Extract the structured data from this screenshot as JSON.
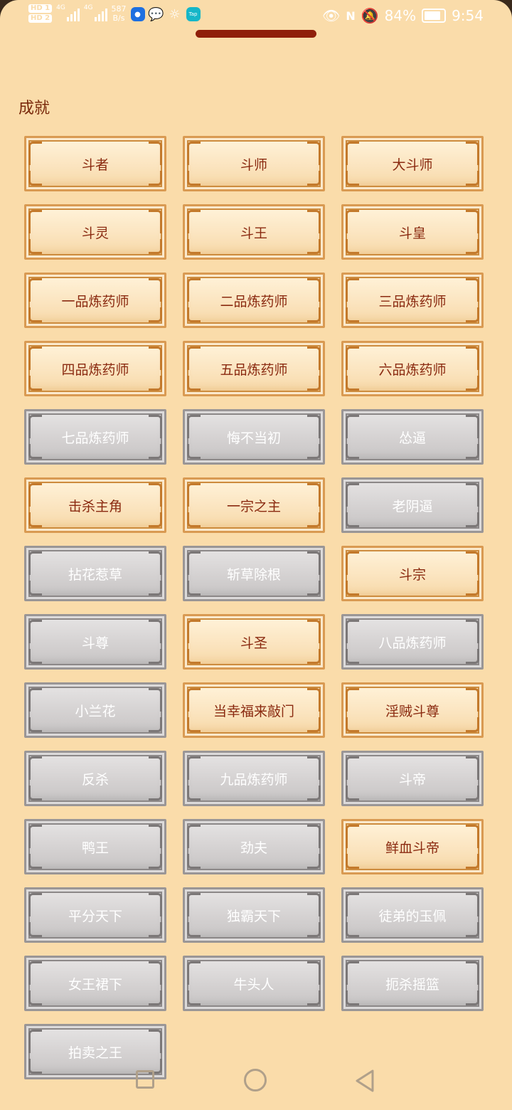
{
  "status_bar": {
    "sim1": "HD 1",
    "sim2": "HD 2",
    "net1": "4G",
    "net2": "4G",
    "speed_value": "587",
    "speed_unit": "B/s",
    "battery": "84%",
    "time": "9:54",
    "icons": [
      "lightbulb-icon",
      "chat-icon",
      "compass-icon",
      "taptap-icon",
      "eye-icon",
      "nfc-icon",
      "mute-icon"
    ]
  },
  "page": {
    "title": "成就"
  },
  "achievements": [
    {
      "label": "斗者",
      "unlocked": true
    },
    {
      "label": "斗师",
      "unlocked": true
    },
    {
      "label": "大斗师",
      "unlocked": true
    },
    {
      "label": "斗灵",
      "unlocked": true
    },
    {
      "label": "斗王",
      "unlocked": true
    },
    {
      "label": "斗皇",
      "unlocked": true
    },
    {
      "label": "一品炼药师",
      "unlocked": true
    },
    {
      "label": "二品炼药师",
      "unlocked": true
    },
    {
      "label": "三品炼药师",
      "unlocked": true
    },
    {
      "label": "四品炼药师",
      "unlocked": true
    },
    {
      "label": "五品炼药师",
      "unlocked": true
    },
    {
      "label": "六品炼药师",
      "unlocked": true
    },
    {
      "label": "七品炼药师",
      "unlocked": false
    },
    {
      "label": "悔不当初",
      "unlocked": false
    },
    {
      "label": "怂逼",
      "unlocked": false
    },
    {
      "label": "击杀主角",
      "unlocked": true
    },
    {
      "label": "一宗之主",
      "unlocked": true
    },
    {
      "label": "老阴逼",
      "unlocked": false
    },
    {
      "label": "拈花惹草",
      "unlocked": false
    },
    {
      "label": "斩草除根",
      "unlocked": false
    },
    {
      "label": "斗宗",
      "unlocked": true
    },
    {
      "label": "斗尊",
      "unlocked": false
    },
    {
      "label": "斗圣",
      "unlocked": true
    },
    {
      "label": "八品炼药师",
      "unlocked": false
    },
    {
      "label": "小兰花",
      "unlocked": false
    },
    {
      "label": "当幸福来敲门",
      "unlocked": true
    },
    {
      "label": "淫贼斗尊",
      "unlocked": true
    },
    {
      "label": "反杀",
      "unlocked": false
    },
    {
      "label": "九品炼药师",
      "unlocked": false
    },
    {
      "label": "斗帝",
      "unlocked": false
    },
    {
      "label": "鸭王",
      "unlocked": false
    },
    {
      "label": "劲夫",
      "unlocked": false
    },
    {
      "label": "鲜血斗帝",
      "unlocked": true
    },
    {
      "label": "平分天下",
      "unlocked": false
    },
    {
      "label": "独霸天下",
      "unlocked": false
    },
    {
      "label": "徒弟的玉佩",
      "unlocked": false
    },
    {
      "label": "女王裙下",
      "unlocked": false
    },
    {
      "label": "牛头人",
      "unlocked": false
    },
    {
      "label": "扼杀摇篮",
      "unlocked": false
    },
    {
      "label": "拍卖之王",
      "unlocked": false
    }
  ],
  "colors": {
    "background": "#fadcaa",
    "title": "#7a2a0c",
    "unlocked_text": "#8a2a10",
    "locked_text": "#ffffff",
    "handle": "#8f1f0a"
  },
  "nav_bar": {
    "icons": [
      "recents-square-icon",
      "home-circle-icon",
      "back-triangle-icon"
    ]
  }
}
